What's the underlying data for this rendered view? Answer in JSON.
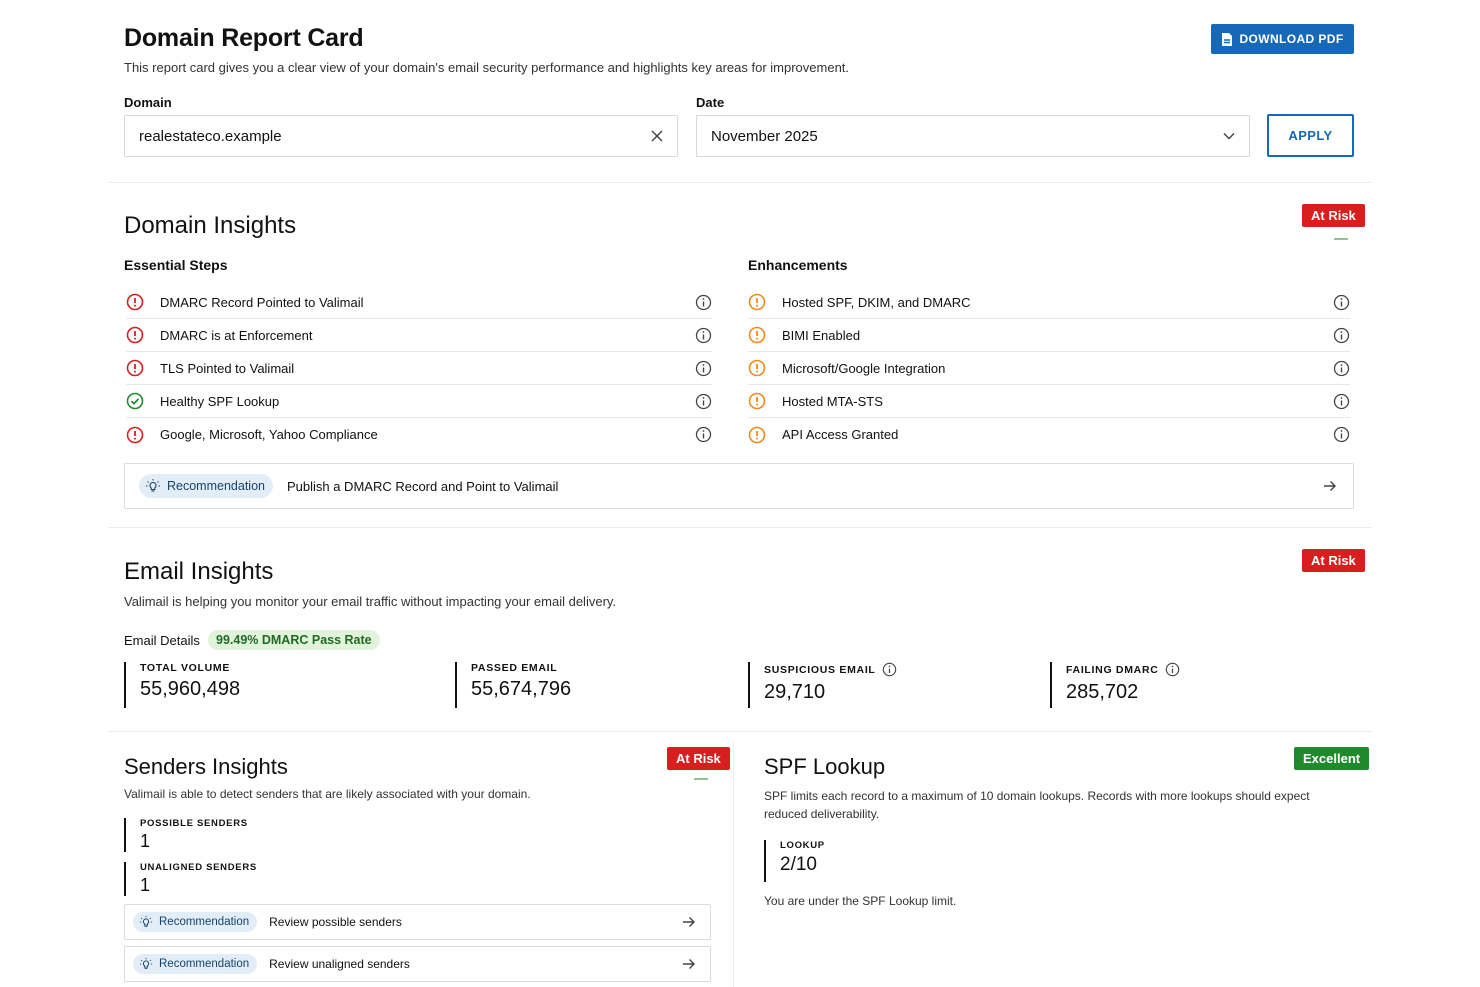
{
  "header": {
    "title": "Domain Report Card",
    "subtitle": "This report card gives you a clear view of your domain's email security performance and highlights key areas for improvement.",
    "download_label": "DOWNLOAD PDF",
    "domain_label": "Domain",
    "domain_value": "realestateco.example",
    "date_label": "Date",
    "date_value": "November 2025",
    "apply_label": "APPLY"
  },
  "domain_insights": {
    "title": "Domain Insights",
    "status": "At Risk",
    "essential_title": "Essential Steps",
    "enhancements_title": "Enhancements",
    "essential_items": [
      {
        "label": "DMARC Record Pointed to Valimail",
        "state": "error"
      },
      {
        "label": "DMARC is at Enforcement",
        "state": "error"
      },
      {
        "label": "TLS Pointed to Valimail",
        "state": "error"
      },
      {
        "label": "Healthy SPF Lookup",
        "state": "ok"
      },
      {
        "label": "Google, Microsoft, Yahoo Compliance",
        "state": "error"
      }
    ],
    "enhancement_items": [
      {
        "label": "Hosted SPF, DKIM, and DMARC",
        "state": "warning"
      },
      {
        "label": "BIMI Enabled",
        "state": "warning"
      },
      {
        "label": "Microsoft/Google Integration",
        "state": "warning"
      },
      {
        "label": "Hosted MTA-STS",
        "state": "warning"
      },
      {
        "label": "API Access Granted",
        "state": "warning"
      }
    ],
    "recommendation_label": "Recommendation",
    "recommendation_text": "Publish a DMARC Record and Point to Valimail"
  },
  "email_insights": {
    "title": "Email Insights",
    "status": "At Risk",
    "subtitle": "Valimail is helping you monitor your email traffic without impacting your email delivery.",
    "details_label": "Email Details",
    "pass_rate": "99.49% DMARC Pass Rate",
    "stats": [
      {
        "label": "TOTAL VOLUME",
        "value": "55,960,498"
      },
      {
        "label": "PASSED EMAIL",
        "value": "55,674,796"
      },
      {
        "label": "SUSPICIOUS EMAIL",
        "value": "29,710"
      },
      {
        "label": "FAILING DMARC",
        "value": "285,702"
      }
    ]
  },
  "senders_insights": {
    "title": "Senders Insights",
    "status": "At Risk",
    "subtitle": "Valimail is able to detect senders that are likely associated with your domain.",
    "possible_label": "POSSIBLE SENDERS",
    "possible_value": "1",
    "unaligned_label": "UNALIGNED SENDERS",
    "unaligned_value": "1",
    "recommendations": [
      {
        "label": "Recommendation",
        "text": "Review possible senders"
      },
      {
        "label": "Recommendation",
        "text": "Review unaligned senders"
      }
    ]
  },
  "spf_lookup": {
    "title": "SPF Lookup",
    "status": "Excellent",
    "subtitle": "SPF limits each record to a maximum of 10 domain lookups. Records with more lookups should expect reduced deliverability.",
    "lookup_label": "LOOKUP",
    "lookup_value": "2/10",
    "note": "You are under the SPF Lookup limit."
  },
  "colors": {
    "primary": "#1768b6",
    "risk": "#d81e1e",
    "excellent": "#1f8a2c",
    "error_icon": "#d81e1e",
    "warning_icon": "#f08a1c",
    "ok_icon": "#1f8a2c"
  }
}
